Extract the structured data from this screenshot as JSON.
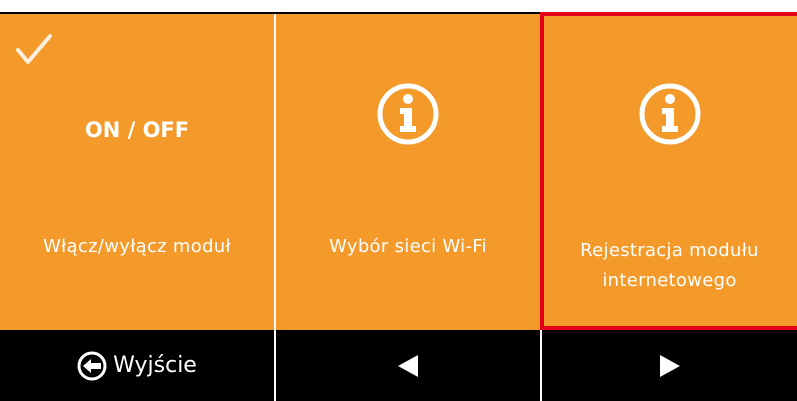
{
  "tiles": [
    {
      "status_icon": "check-icon",
      "title": "ON / OFF",
      "label": "Włącz/wyłącz moduł"
    },
    {
      "icon": "info-icon",
      "label": "Wybór sieci Wi-Fi"
    },
    {
      "icon": "info-icon",
      "label": "Rejestracja modułu internetowego",
      "selected": true
    }
  ],
  "bottom_bar": {
    "exit_label": "Wyjście",
    "exit_icon": "exit-icon",
    "prev_icon": "triangle-left-icon",
    "next_icon": "triangle-right-icon"
  },
  "colors": {
    "tile_background": "#f39a2b",
    "selection_border": "#e2001a",
    "bar_background": "#000000",
    "text": "#ffffff"
  }
}
